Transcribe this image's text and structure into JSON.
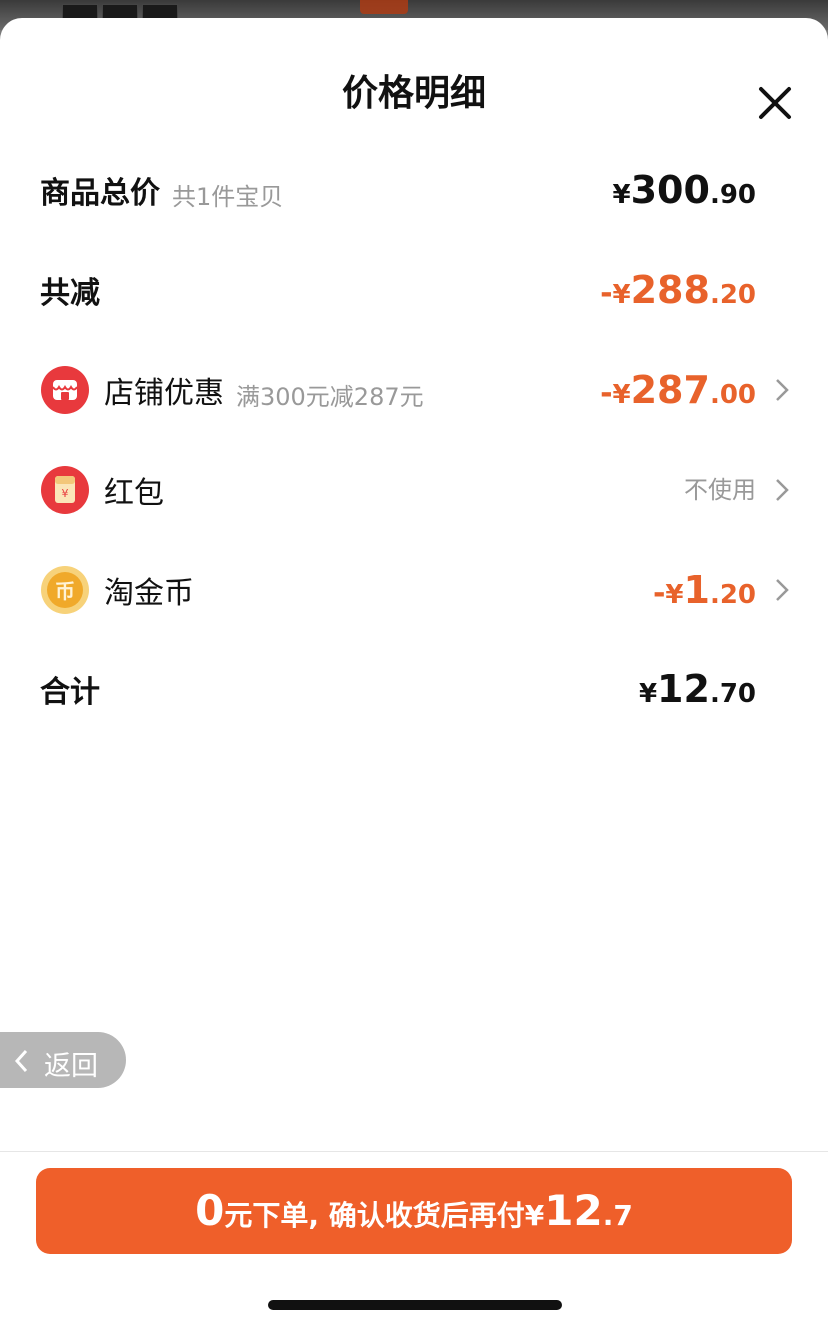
{
  "header": {
    "title": "价格明细",
    "close_icon": "close-icon"
  },
  "rows": {
    "subtotal": {
      "label": "商品总价",
      "sub": "共1件宝贝",
      "currency": "¥",
      "int": "300",
      "dec": ".90"
    },
    "discount": {
      "label": "共减",
      "sign": "-",
      "currency": "¥",
      "int": "288",
      "dec": ".20"
    },
    "shop_offer": {
      "label": "店铺优惠",
      "sub": "满300元减287元",
      "sign": "-",
      "currency": "¥",
      "int": "287",
      "dec": ".00",
      "icon": "shop-icon"
    },
    "red_packet": {
      "label": "红包",
      "value": "不使用",
      "icon": "red-packet-icon"
    },
    "gold_coin": {
      "label": "淘金币",
      "sign": "-",
      "currency": "¥",
      "int": "1",
      "dec": ".20",
      "icon": "gold-coin-icon"
    },
    "total": {
      "label": "合计",
      "currency": "¥",
      "int": "12",
      "dec": ".70"
    }
  },
  "back_button": {
    "label": "返回"
  },
  "cta": {
    "zero": "0",
    "text": "元下单, 确认收货后再付",
    "currency": "¥",
    "int": "12",
    "dec": ".7"
  },
  "colors": {
    "accent": "#ef5f2a",
    "discount": "#e8622b",
    "shop_icon": "#e8393d",
    "coin": "#f0a92a"
  }
}
